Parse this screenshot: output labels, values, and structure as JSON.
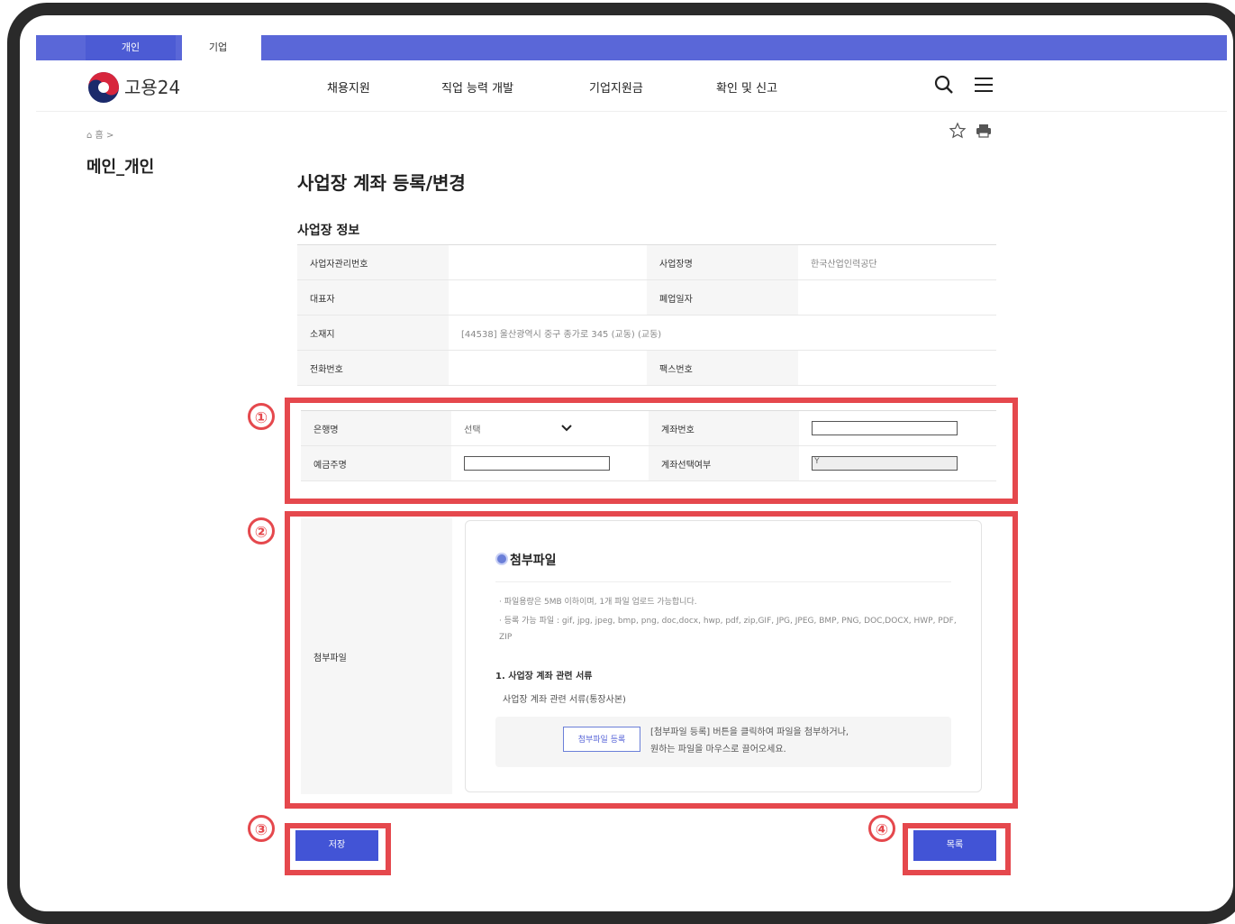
{
  "top_tabs": [
    {
      "label": "개인"
    },
    {
      "label": "기업"
    }
  ],
  "header": {
    "logo_text": "고용24",
    "nav": [
      {
        "label": "채용지원"
      },
      {
        "label": "직업 능력 개발"
      },
      {
        "label": "기업지원금"
      },
      {
        "label": "확인 및 신고"
      }
    ],
    "icons": [
      "search-icon",
      "menu-icon"
    ]
  },
  "breadcrumb": {
    "home_label": "홈",
    "separator": ">"
  },
  "utility_icons": [
    "star-icon",
    "print-icon"
  ],
  "sidebar": {
    "title": "메인_개인"
  },
  "page": {
    "title": "사업장 계좌 등록/변경",
    "section_title": "사업장 정보"
  },
  "info_table": {
    "rows": [
      [
        {
          "label": "사업자관리번호",
          "value": ""
        },
        {
          "label": "사업장명",
          "value": "한국산업인력공단"
        }
      ],
      [
        {
          "label": "대표자",
          "value": ""
        },
        {
          "label": "폐업일자",
          "value": ""
        }
      ],
      [
        {
          "label": "소재지",
          "value": "[44538] 울산광역시 중구 종가로 345 (교동) (교동)"
        }
      ],
      [
        {
          "label": "전화번호",
          "value": ""
        },
        {
          "label": "팩스번호",
          "value": ""
        }
      ]
    ]
  },
  "account_form": {
    "bank_label": "은행명",
    "bank_select": "선택",
    "account_no_label": "계좌번호",
    "account_no_value": "",
    "holder_label": "예금주명",
    "holder_value": "",
    "account_confirm_label": "계좌선택여부",
    "account_confirm_value": "Y"
  },
  "attachment": {
    "row_label": "첨부파일",
    "title": "첨부파일",
    "notes": [
      "· 파일용량은 5MB 이하이며, 1개 파일 업로드 가능합니다.",
      "· 등록 가능 파일 : gif, jpg, jpeg, bmp, png, doc,docx, hwp, pdf, zip,GIF, JPG, JPEG, BMP, PNG, DOC,DOCX, HWP, PDF, ZIP"
    ],
    "item_title": "1. 사업장 계좌 관련 서류",
    "item_desc": "사업장 계좌 관련 서류(통장사본)",
    "upload_button": "첨부파일 등록",
    "drop_text_line1": "[첨부파일 등록] 버튼을 클릭하여 파일을 첨부하거나,",
    "drop_text_line2": "원하는 파일을 마우스로 끌어오세요."
  },
  "buttons": {
    "save": "저장",
    "list": "목록"
  },
  "markers": [
    "①",
    "②",
    "③",
    "④"
  ],
  "colors": {
    "accent": "#4254d6",
    "topbar": "#5a67d8",
    "highlight": "#e5484d"
  }
}
